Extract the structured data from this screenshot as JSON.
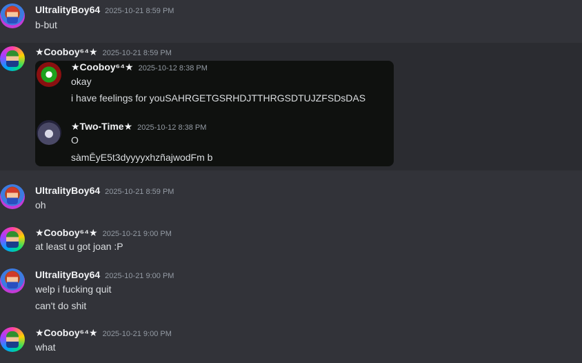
{
  "messages": [
    {
      "user": "UltralityBoy64",
      "time": "2025-10-21 8:59 PM",
      "lines": [
        "b-but"
      ]
    },
    {
      "user": "★Cooboy⁶⁴★",
      "time": "2025-10-21 8:59 PM",
      "forwarded": [
        {
          "user": "★Cooboy⁶⁴★",
          "time": "2025-10-12 8:38 PM",
          "lines": [
            "okay",
            "i have feelings for youSAHRGETGSRHDJTTHRGSDTUJZFSDsDAS"
          ]
        },
        {
          "user": "★Two-Time★",
          "time": "2025-10-12 8:38 PM",
          "lines": [
            "O",
            "sàmĒyE5t3dyyyyxhzñajwodFm b"
          ]
        }
      ]
    },
    {
      "user": "UltralityBoy64",
      "time": "2025-10-21 8:59 PM",
      "lines": [
        "oh"
      ]
    },
    {
      "user": "★Cooboy⁶⁴★",
      "time": "2025-10-21 9:00 PM",
      "lines": [
        "at least u got joan :P"
      ]
    },
    {
      "user": "UltralityBoy64",
      "time": "2025-10-21 9:00 PM",
      "lines": [
        "welp i fucking quit",
        "can't do shit"
      ]
    },
    {
      "user": "★Cooboy⁶⁴★",
      "time": "2025-10-21 9:00 PM",
      "lines": [
        "what"
      ]
    }
  ]
}
